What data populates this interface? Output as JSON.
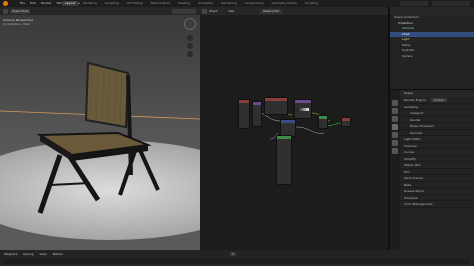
{
  "menu": [
    "File",
    "Edit",
    "Render",
    "Window",
    "Help"
  ],
  "tabs": [
    "Layout",
    "Modeling",
    "Sculpting",
    "UV Editing",
    "Texture Paint",
    "Shading",
    "Animation",
    "Rendering",
    "Compositing",
    "Geometry Nodes",
    "Scripting"
  ],
  "viewport": {
    "mode": "Object Mode",
    "overlay_title": "Camera Perspective",
    "overlay_sub": "(1) Collection | Chair"
  },
  "node_editor": {
    "mode": "Object",
    "label": "View",
    "material": "Material.001"
  },
  "outliner": {
    "items": [
      "Scene Collection",
      "Collection",
      "Camera",
      "Chair",
      "Light",
      "Plane",
      "Cylinder",
      "Sphere"
    ]
  },
  "properties": {
    "title": "Scene",
    "engine_label": "Render Engine",
    "engine": "Cycles",
    "sections": [
      "Sampling",
      "Light Paths",
      "Volumes",
      "Curves",
      "Simplify",
      "Motion Blur",
      "Film",
      "Performance",
      "Bake",
      "Grease Pencil",
      "Freestyle",
      "Color Management"
    ],
    "sampling_sub": [
      "Viewport",
      "Render",
      "Noise Threshold",
      "Denoise"
    ]
  },
  "timeline": {
    "items": [
      "Playback",
      "Keying",
      "View",
      "Marker"
    ],
    "frame": "1"
  }
}
